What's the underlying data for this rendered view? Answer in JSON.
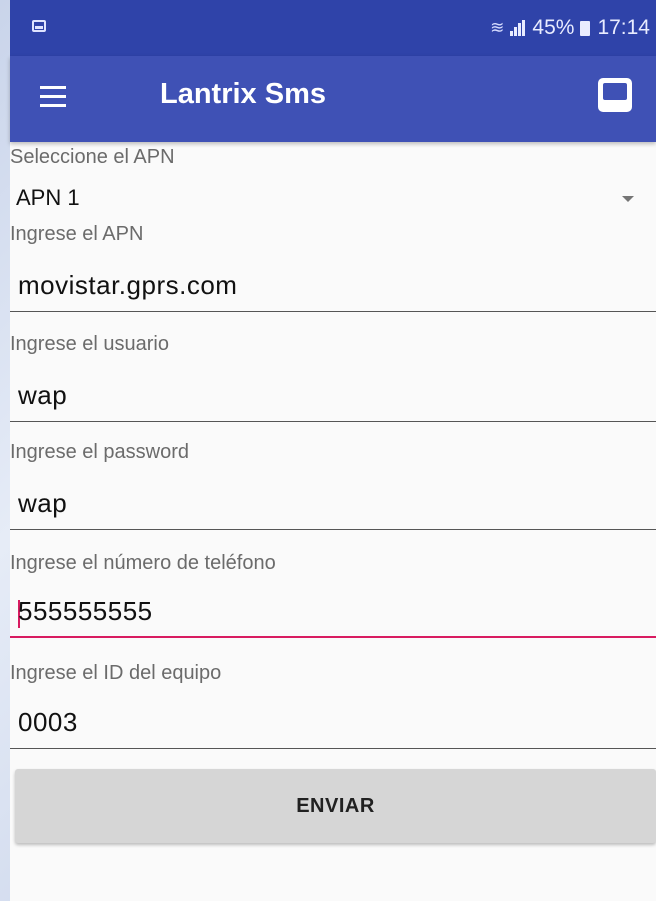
{
  "status_bar": {
    "battery_percent": "45%",
    "time": "17:14",
    "icons": [
      "notification-icon",
      "wifi-icon",
      "signal-icon",
      "battery-icon"
    ]
  },
  "app_bar": {
    "title": "Lantrix Sms",
    "icons": [
      "menu-icon",
      "inbox-icon"
    ]
  },
  "form": {
    "apn_select": {
      "label": "Seleccione el APN",
      "selected": "APN 1"
    },
    "apn": {
      "label": "Ingrese el APN",
      "value": "movistar.gprs.com"
    },
    "user": {
      "label": "Ingrese el usuario",
      "value": "wap"
    },
    "password": {
      "label": "Ingrese el password",
      "value": "wap"
    },
    "phone": {
      "label": "Ingrese el número de teléfono",
      "value": "555555555"
    },
    "device_id": {
      "label": "Ingrese el ID del equipo",
      "value": "0003"
    },
    "submit_label": "ENVIAR"
  },
  "colors": {
    "status_bar": "#2f43a9",
    "app_bar": "#3f51b5",
    "focus_accent": "#d81b60",
    "button_bg": "#d6d6d6"
  }
}
